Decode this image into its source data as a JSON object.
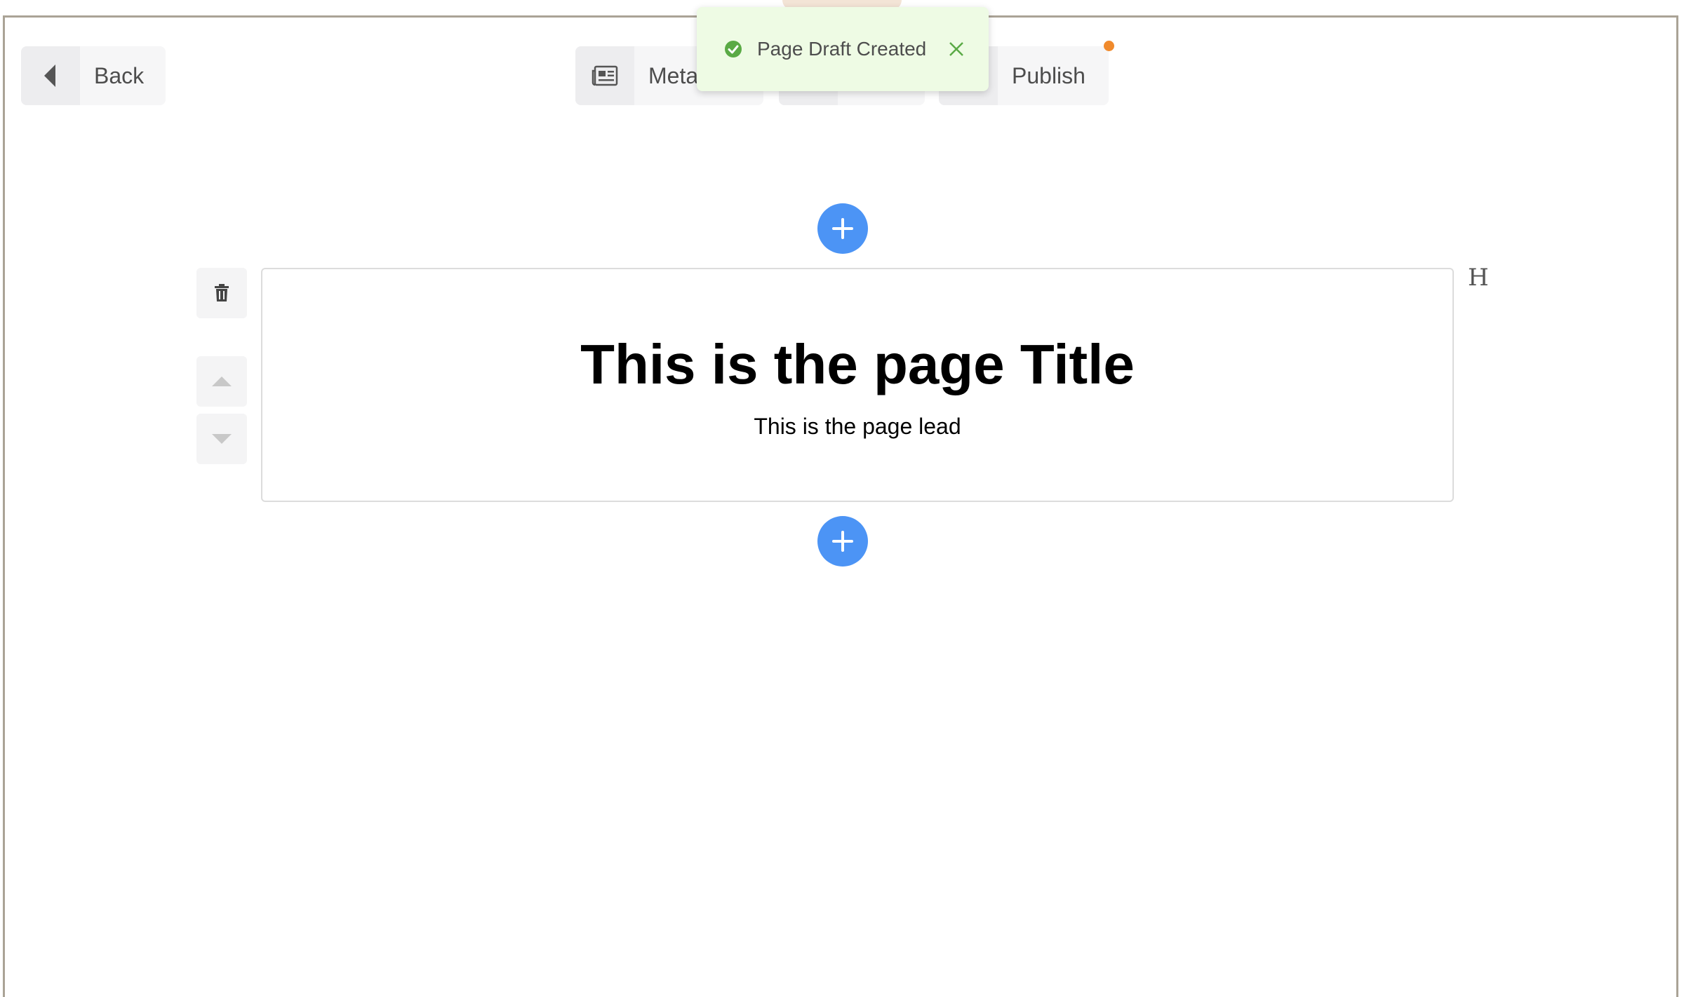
{
  "toolbar": {
    "back_label": "Back",
    "meta_label": "Meta",
    "middle_label": "",
    "publish_label": "Publish"
  },
  "toast": {
    "message": "Page Draft Created"
  },
  "block": {
    "title": "This is the page Title",
    "lead": "This is the page lead",
    "heading_marker": "H"
  },
  "colors": {
    "accent_blue": "#4c94f5",
    "notify_dot": "#f08a2c",
    "toast_green": "#5aaa45",
    "frame_border": "#aaa396"
  },
  "icons": {
    "back": "caret-left-icon",
    "meta": "newspaper-icon",
    "toast_ok": "check-circle-icon",
    "toast_close": "close-icon",
    "add": "plus-icon",
    "trash": "trash-icon",
    "up": "caret-up-icon",
    "down": "caret-down-icon"
  }
}
